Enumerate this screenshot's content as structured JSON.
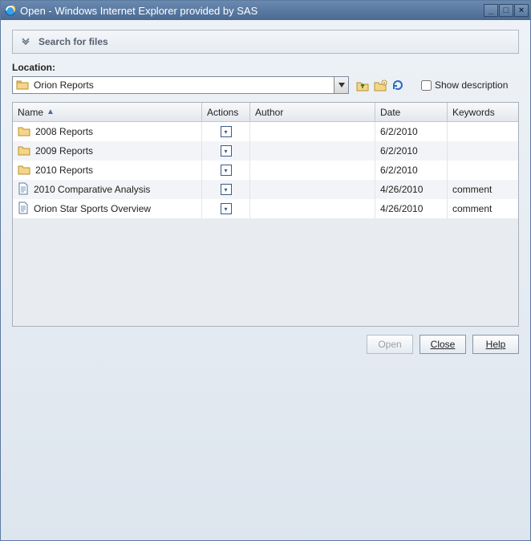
{
  "window": {
    "title": "Open - Windows Internet Explorer provided by SAS"
  },
  "search": {
    "label": "Search for files"
  },
  "location": {
    "label": "Location:",
    "selected": "Orion Reports",
    "show_description_label": "Show description"
  },
  "columns": {
    "name": "Name",
    "actions": "Actions",
    "author": "Author",
    "date": "Date",
    "keywords": "Keywords"
  },
  "rows": [
    {
      "type": "folder",
      "name": "2008 Reports",
      "author": "",
      "date": "6/2/2010",
      "keywords": ""
    },
    {
      "type": "folder",
      "name": "2009 Reports",
      "author": "",
      "date": "6/2/2010",
      "keywords": ""
    },
    {
      "type": "folder",
      "name": "2010 Reports",
      "author": "",
      "date": "6/2/2010",
      "keywords": ""
    },
    {
      "type": "document",
      "name": "2010 Comparative Analysis",
      "author": "",
      "date": "4/26/2010",
      "keywords": "comment"
    },
    {
      "type": "document",
      "name": "Orion Star Sports Overview",
      "author": "",
      "date": "4/26/2010",
      "keywords": "comment"
    }
  ],
  "buttons": {
    "open": "Open",
    "close": "Close",
    "help": "Help"
  }
}
